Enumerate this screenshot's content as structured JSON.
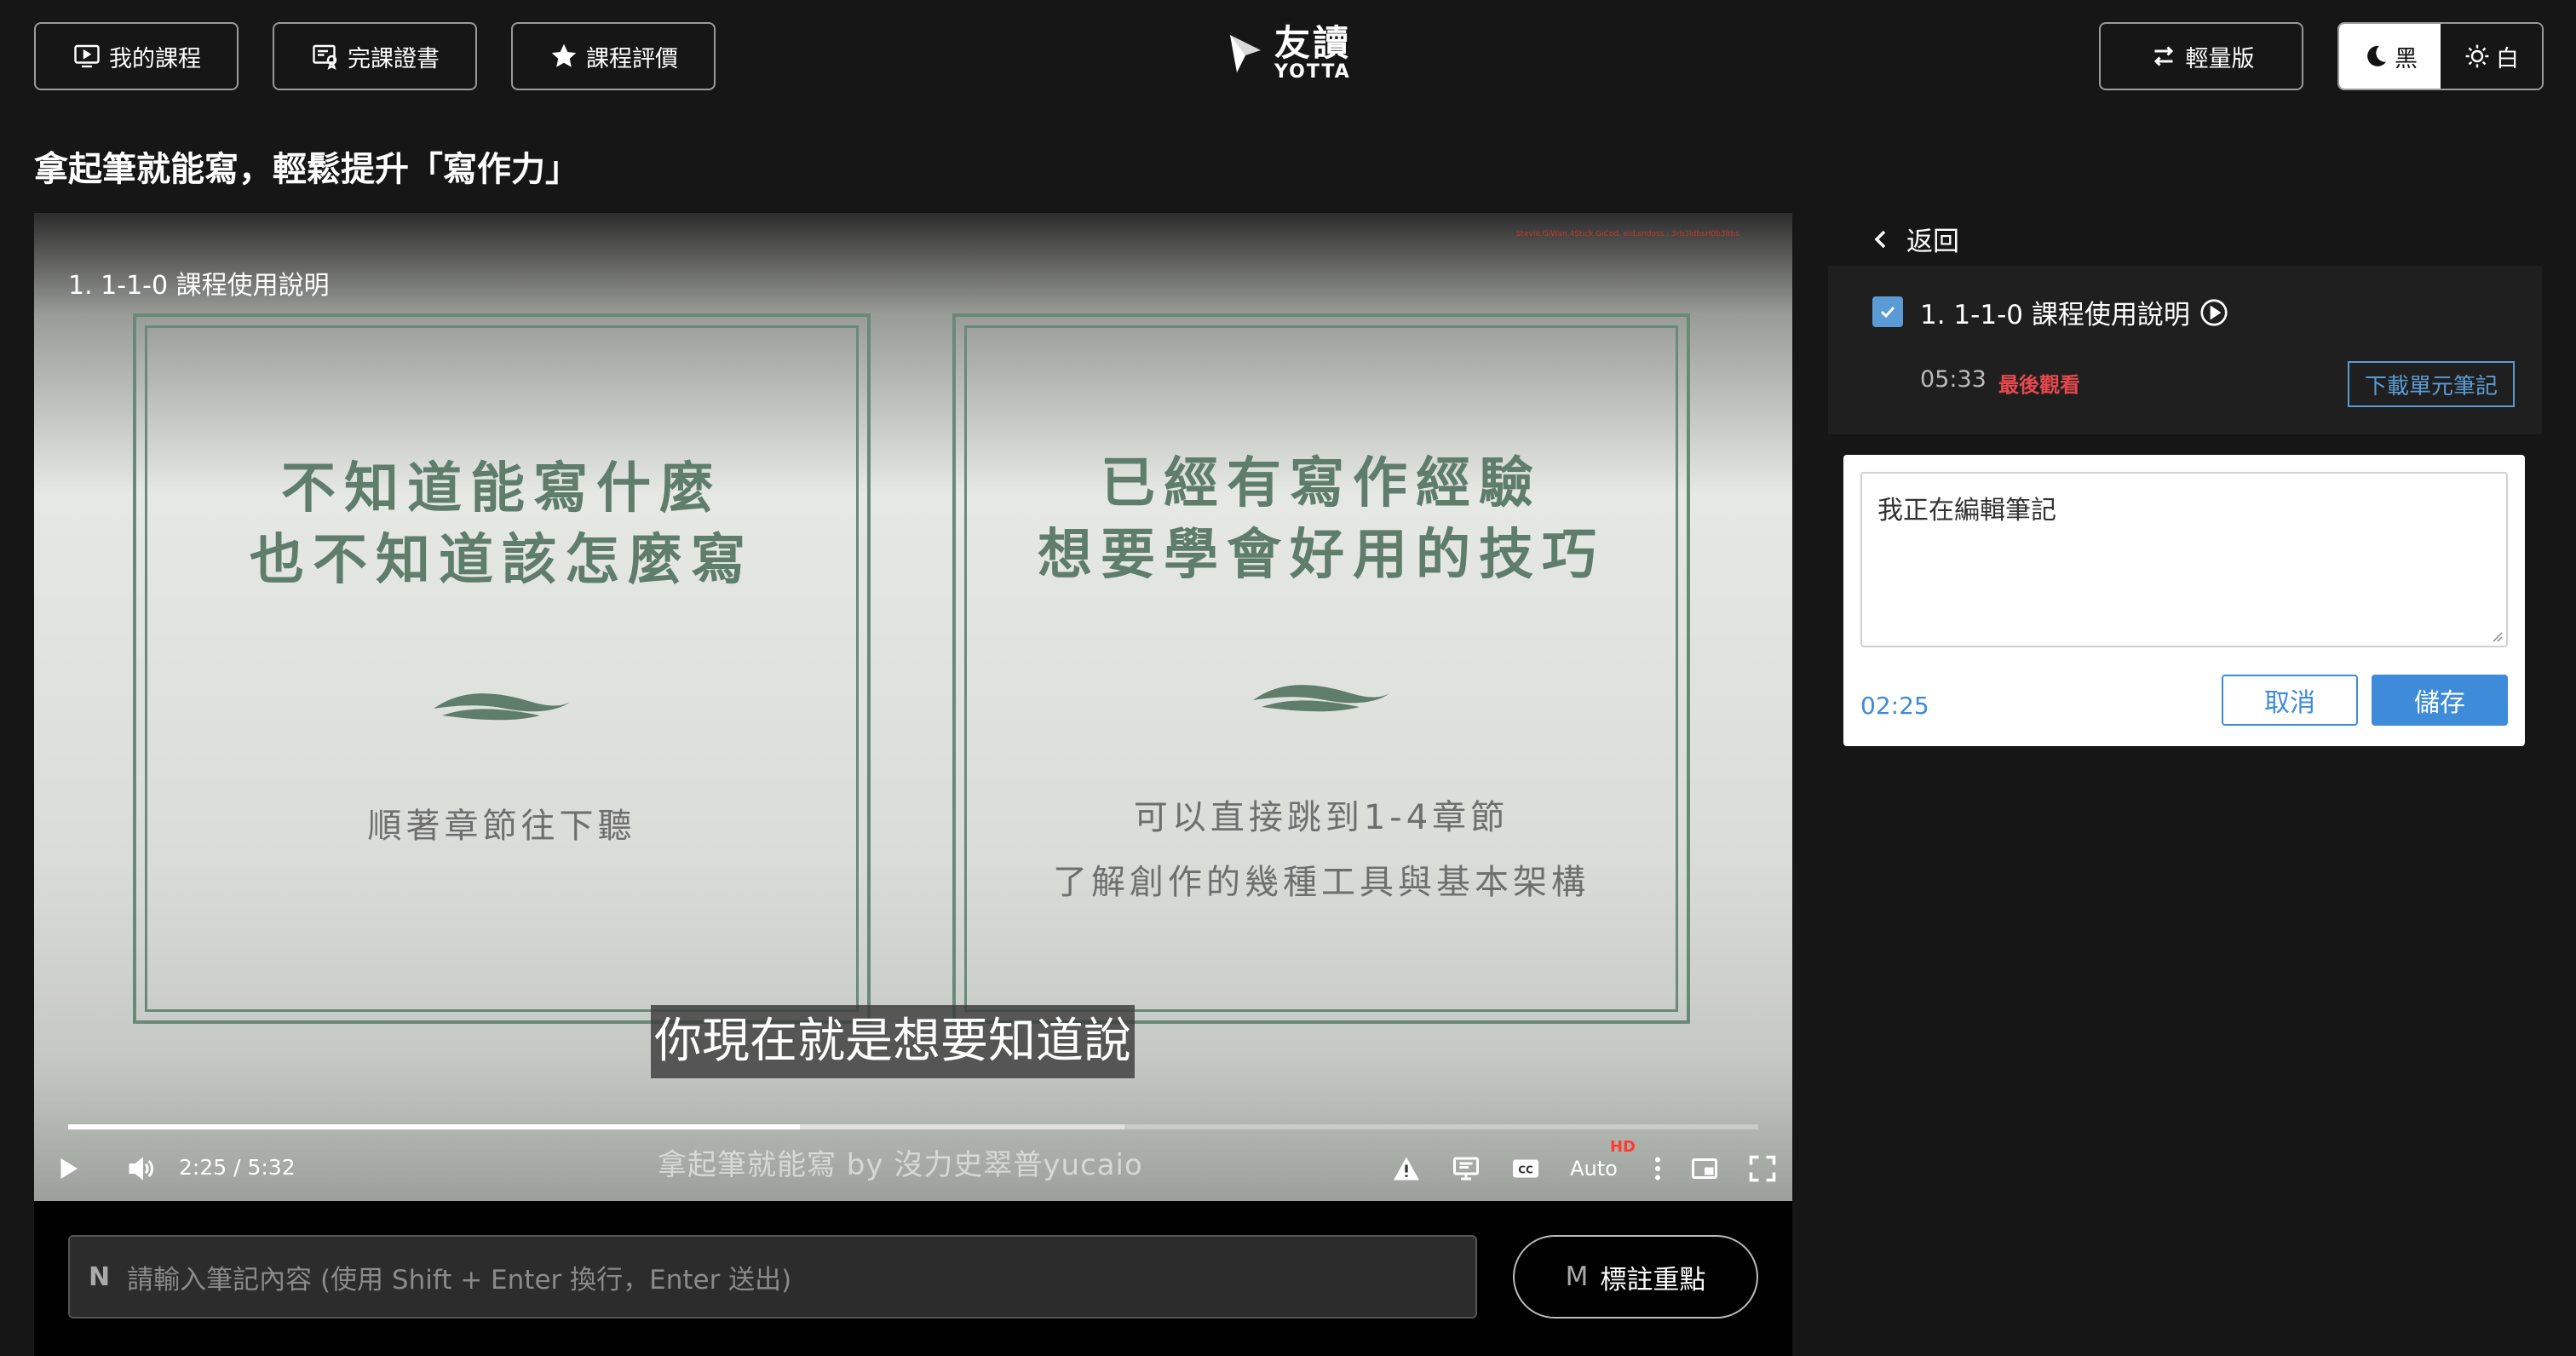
{
  "header": {
    "my_courses": "我的課程",
    "certificate": "完課證書",
    "course_review": "課程評價",
    "logo_cn": "友讀",
    "logo_en": "YOTTA",
    "lite_version": "輕量版",
    "theme_dark": "黑",
    "theme_light": "白",
    "active_theme": "dark"
  },
  "course": {
    "title": "拿起筆就能寫，輕鬆提升「寫作力」"
  },
  "video": {
    "top_label": "1. 1-1-0 課程使用說明",
    "watermark": "Stevie.GiWan.4Stick.GiCod. eid.sndoss : 3rb3ldbsH0b3ltbs",
    "cards": [
      {
        "line1": "不知道能寫什麼",
        "line2": "也不知道該怎麼寫",
        "sub1": "順著章節往下聽",
        "sub2": ""
      },
      {
        "line1": "已經有寫作經驗",
        "line2": "想要學會好用的技巧",
        "sub1": "可以直接跳到1-4章節",
        "sub2": "了解創作的幾種工具與基本架構"
      }
    ],
    "subtitle": "你現在就是想要知道說",
    "time": "2:25 / 5:32",
    "progress": 0.433,
    "buffered": 0.625,
    "brand_line": "拿起筆就能寫 by 沒力史翠普yucaio",
    "quality": "Auto",
    "hd_badge": "HD"
  },
  "note_bar": {
    "key_hint": "N",
    "placeholder": "請輸入筆記內容 (使用 Shift + Enter 換行，Enter 送出)",
    "mark_key": "M",
    "mark_label": "標註重點"
  },
  "sidebar": {
    "back_label": "返回",
    "chapter": {
      "title": "1. 1-1-0 課程使用說明",
      "duration": "05:33",
      "status": "最後觀看",
      "download_label": "下載單元筆記",
      "checked": true
    },
    "note_editor": {
      "text": "我正在編輯筆記",
      "timestamp": "02:25",
      "cancel_label": "取消",
      "save_label": "儲存"
    }
  },
  "colors": {
    "background": "#161616",
    "accent_blue": "#3d8bd9",
    "slide_green": "#5f7d6b",
    "status_red": "#e5484d"
  }
}
